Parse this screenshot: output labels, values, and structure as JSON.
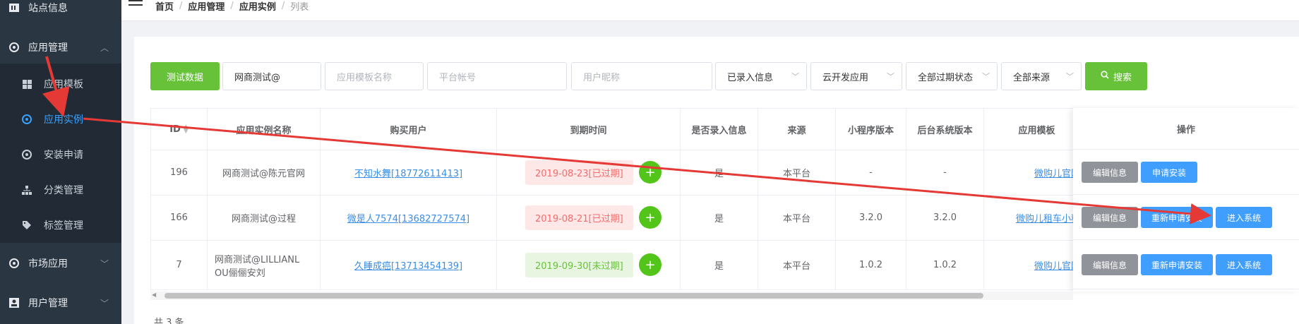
{
  "sidebar": {
    "top_item": "站点信息",
    "app_mgmt": "应用管理",
    "sub_items": [
      "应用模板",
      "应用实例",
      "安装申请",
      "分类管理",
      "标签管理"
    ],
    "market": "市场应用",
    "users": "用户管理"
  },
  "breadcrumb": [
    "首页",
    "应用管理",
    "应用实例",
    "列表"
  ],
  "filters": {
    "test_data_btn": "测试数据",
    "name_value": "网商测试@",
    "template_placeholder": "应用模板名称",
    "platform_placeholder": "平台帐号",
    "nickname_placeholder": "用户昵称",
    "info_select": "已录入信息",
    "dev_select": "云开发应用",
    "expiry_select": "全部过期状态",
    "source_select": "全部来源",
    "search_btn": "搜索"
  },
  "table": {
    "headers": [
      "ID",
      "应用实例名称",
      "购买用户",
      "到期时间",
      "是否录入信息",
      "来源",
      "小程序版本",
      "后台系统版本",
      "应用模板",
      "操作"
    ],
    "rows": [
      {
        "id": "196",
        "name": "网商测试@陈元官网",
        "user": "不知水舞[18772611413]",
        "expire": "2019-08-23[已过期]",
        "entered": "是",
        "source": "本平台",
        "mini_ver": "-",
        "backend_ver": "-",
        "template": "微购儿官网小"
      },
      {
        "id": "166",
        "name": "网商测试@过程",
        "user": "微是人7574[13682727574]",
        "expire": "2019-08-21[已过期]",
        "entered": "是",
        "source": "本平台",
        "mini_ver": "3.2.0",
        "backend_ver": "3.2.0",
        "template": "微购儿租车小程序"
      },
      {
        "id": "7",
        "name_line1": "网商测试@LILLIANL",
        "name_line2": "OU俪俪安刘",
        "user": "久睡成癌[13713454139]",
        "expire": "2019-09-30[未过期]",
        "entered": "是",
        "source": "本平台",
        "mini_ver": "1.0.2",
        "backend_ver": "1.0.2",
        "template": "微购儿官网小"
      }
    ],
    "actions": {
      "edit": "编辑信息",
      "apply_install": "申请安装",
      "reapply_install": "重新申请安装",
      "enter_system": "进入系统"
    }
  },
  "footer": {
    "total": "共 3 条"
  },
  "colors": {
    "sidebar": "#2b3643",
    "active": "#3aa0ff",
    "green": "#67c23a",
    "blue": "#409eff",
    "gray": "#909399",
    "arrow": "#e53935"
  }
}
